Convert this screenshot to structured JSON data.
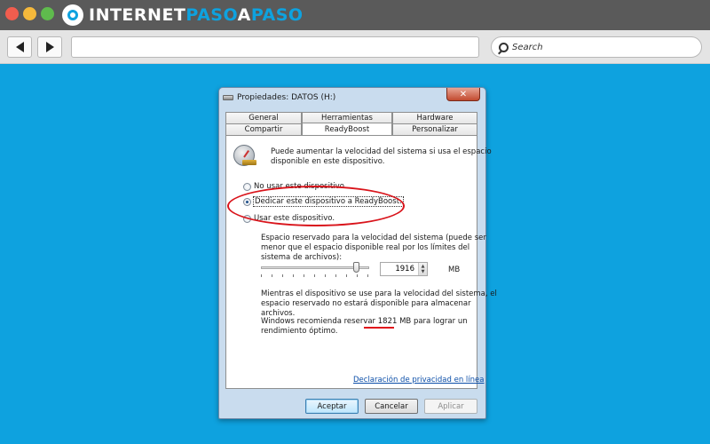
{
  "browser": {
    "logo_part1": "INTERNET",
    "logo_part2": "PASO",
    "logo_part3": "A",
    "logo_part4": "PASO",
    "search_placeholder": "Search",
    "colors": {
      "titlebar": "#5a5a5a",
      "background": "#0ea2df",
      "close_dot": "#f15d4e",
      "min_dot": "#f5b93b",
      "max_dot": "#5fbb4d"
    }
  },
  "dialog": {
    "title": "Propiedades: DATOS (H:)",
    "close_label": "✕",
    "tabs_back": [
      "General",
      "Herramientas",
      "Hardware"
    ],
    "tabs_front": [
      "Compartir",
      "ReadyBoost",
      "Personalizar"
    ],
    "active_tab": "ReadyBoost",
    "intro_line1": "Puede aumentar la velocidad del sistema si usa el espacio",
    "intro_line2": "disponible en este dispositivo.",
    "options": [
      {
        "label": "No usar este dispositivo.",
        "selected": false
      },
      {
        "label": "Dedicar este dispositivo a ReadyBoost.",
        "selected": true
      },
      {
        "label": "Usar este dispositivo.",
        "selected": false
      }
    ],
    "reserve_line1": "Espacio reservado para la velocidad del sistema (puede ser",
    "reserve_line2": "menor que el espacio disponible real por los límites del",
    "reserve_line3": "sistema de archivos):",
    "reserve_value": "1916",
    "reserve_unit": "MB",
    "slider_fraction": 0.92,
    "note_line1": "Mientras el dispositivo se use para la velocidad del sistema, el",
    "note_line2": "espacio reservado no estará disponible para almacenar",
    "note_line3": "archivos.",
    "recommend_prefix": "Windows recomienda reservar",
    "recommend_value": "1821 MB",
    "recommend_suffix": "para lograr un",
    "recommend_line2": "rendimiento óptimo.",
    "privacy_link": "Declaración de privacidad en línea",
    "buttons": {
      "ok": "Aceptar",
      "cancel": "Cancelar",
      "apply": "Aplicar"
    },
    "highlight_color": "#d9141b"
  }
}
